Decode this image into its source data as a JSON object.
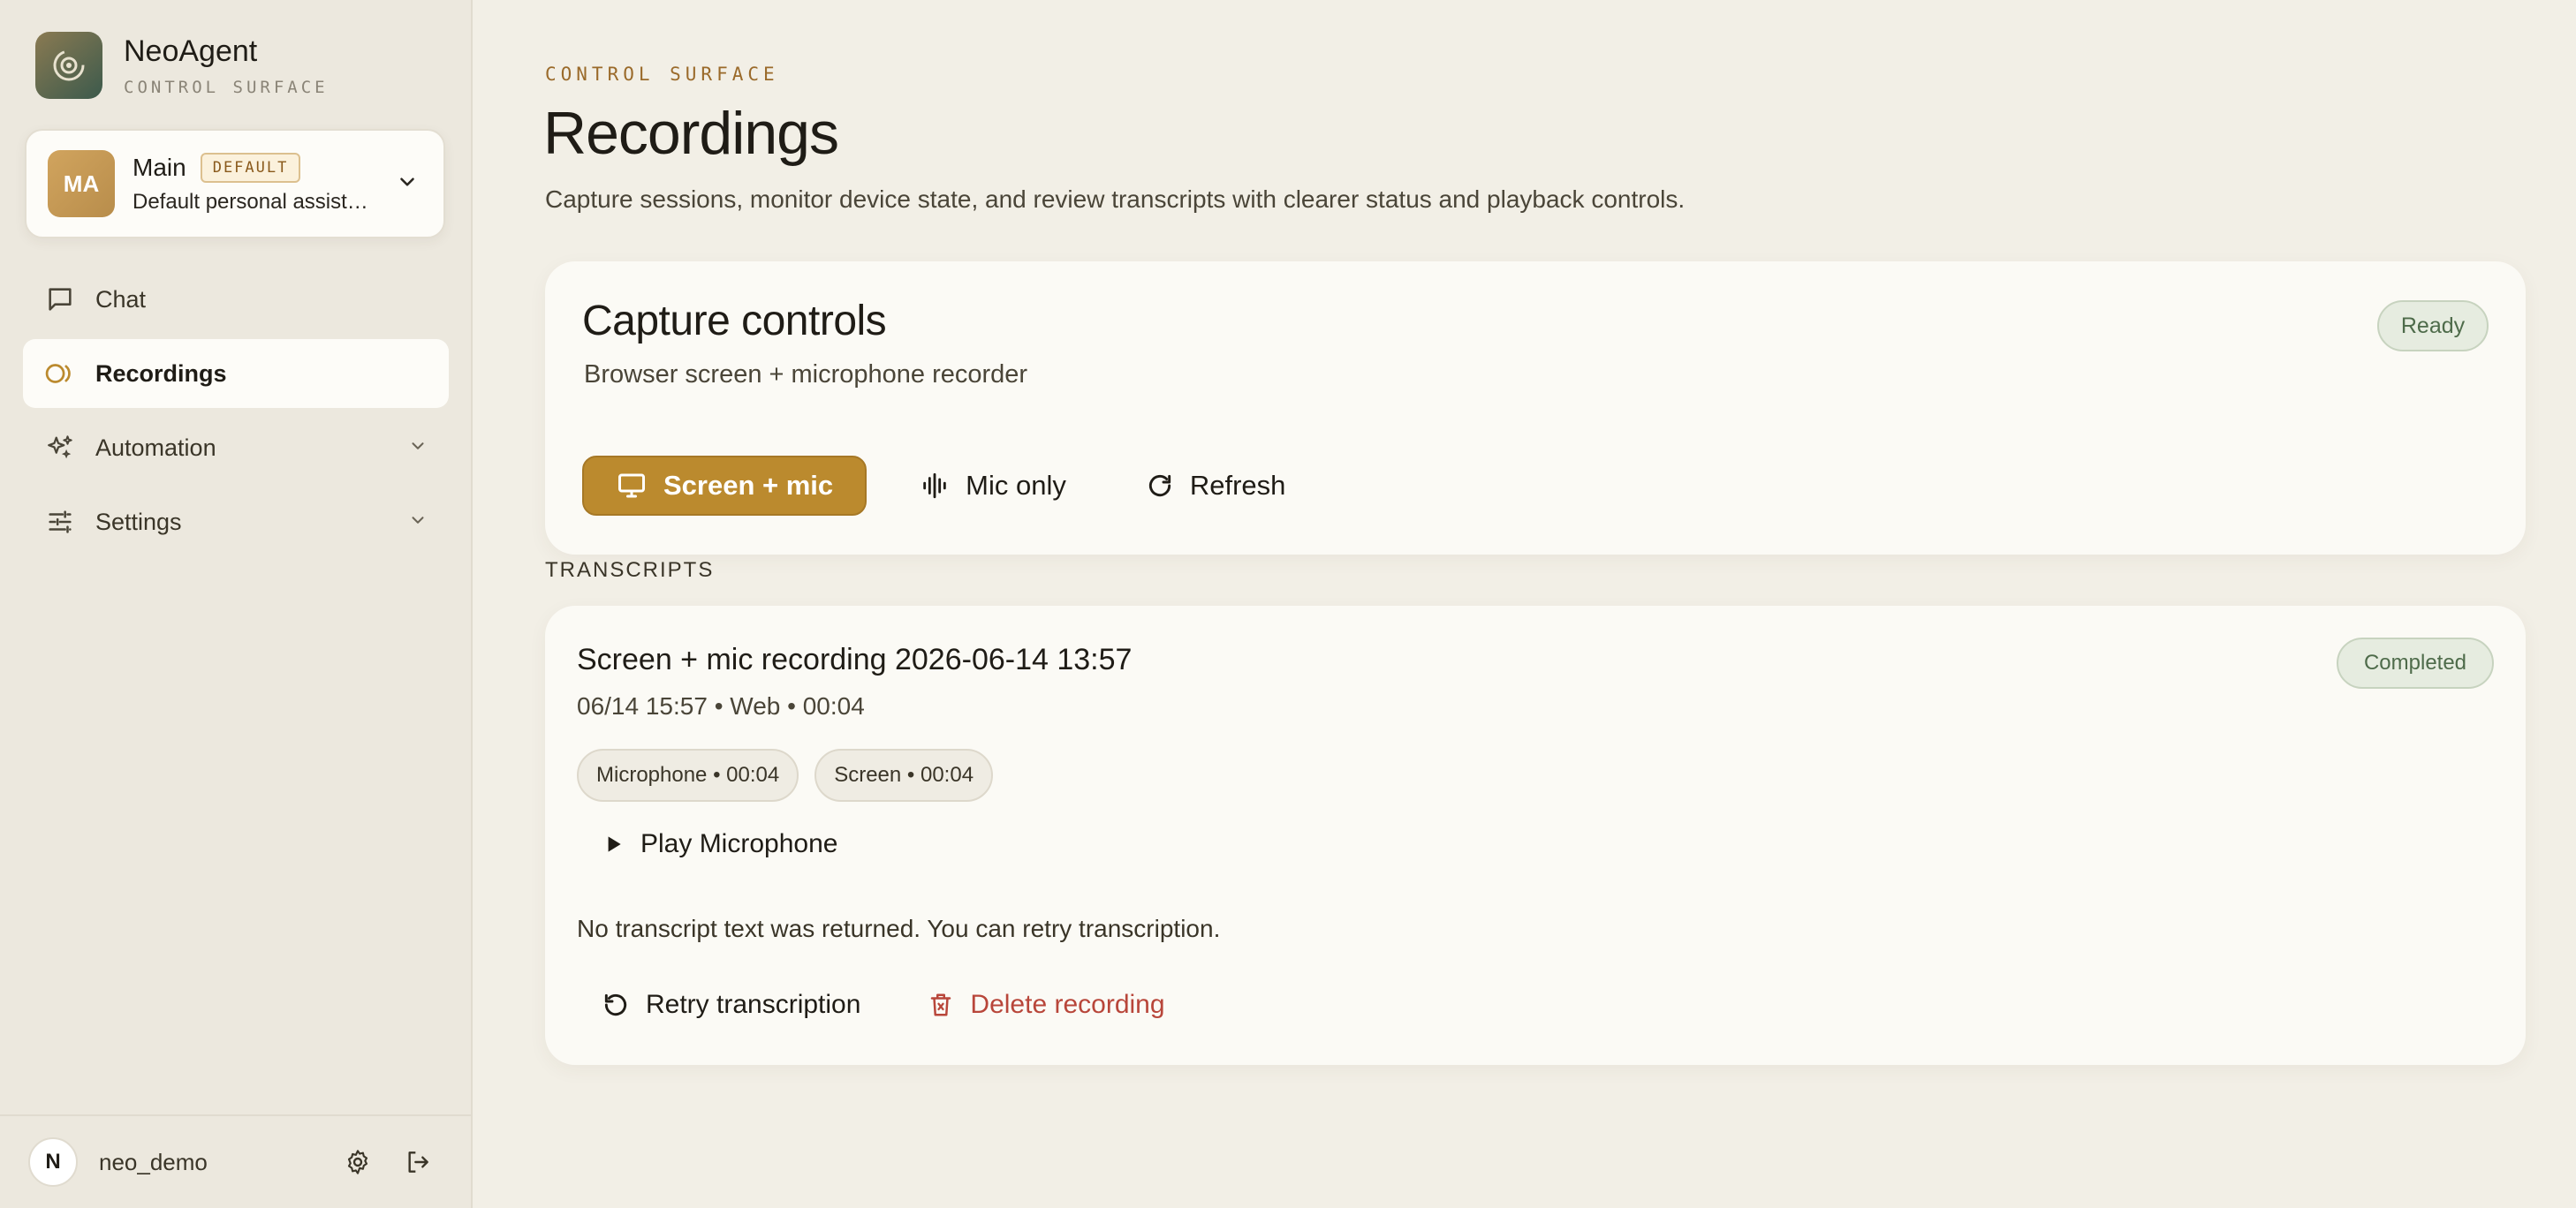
{
  "brand": {
    "name": "NeoAgent",
    "subtitle": "CONTROL SURFACE",
    "logo_icon": "agent-logo-icon"
  },
  "agent": {
    "initials": "MA",
    "name": "Main",
    "badge": "DEFAULT",
    "description": "Default personal assistant",
    "chevron_icon": "chevron-down-icon"
  },
  "nav": {
    "items": [
      {
        "label": "Chat",
        "icon": "chat-bubble-icon",
        "active": false
      },
      {
        "label": "Recordings",
        "icon": "recordings-icon",
        "active": true
      },
      {
        "label": "Automation",
        "icon": "sparkles-icon",
        "expandable": true
      },
      {
        "label": "Settings",
        "icon": "sliders-icon",
        "expandable": true
      }
    ]
  },
  "user": {
    "initial": "N",
    "name": "neo_demo",
    "settings_icon": "gear-icon",
    "logout_icon": "logout-icon"
  },
  "page": {
    "eyebrow": "CONTROL SURFACE",
    "title": "Recordings",
    "subtitle": "Capture sessions, monitor device state, and review transcripts with clearer status and playback controls."
  },
  "capture": {
    "title": "Capture controls",
    "subtitle": "Browser screen + microphone recorder",
    "status": "Ready",
    "buttons": {
      "screen_mic": "Screen + mic",
      "mic_only": "Mic only",
      "refresh": "Refresh"
    }
  },
  "transcripts": {
    "section_label": "TRANSCRIPTS",
    "items": [
      {
        "title": "Screen + mic recording 2026-06-14 13:57",
        "meta": "06/14 15:57 • Web • 00:04",
        "status": "Completed",
        "chips": [
          "Microphone • 00:04",
          "Screen • 00:04"
        ],
        "play_label": "Play Microphone",
        "message": "No transcript text was returned. You can retry transcription.",
        "retry_label": "Retry transcription",
        "delete_label": "Delete recording"
      }
    ]
  },
  "colors": {
    "accent": "#bb8a2e",
    "danger": "#b8463a",
    "success_text": "#4e6b4a",
    "background": "#f2efe6",
    "sidebar": "#ece8de",
    "card": "#fbfaf5"
  }
}
